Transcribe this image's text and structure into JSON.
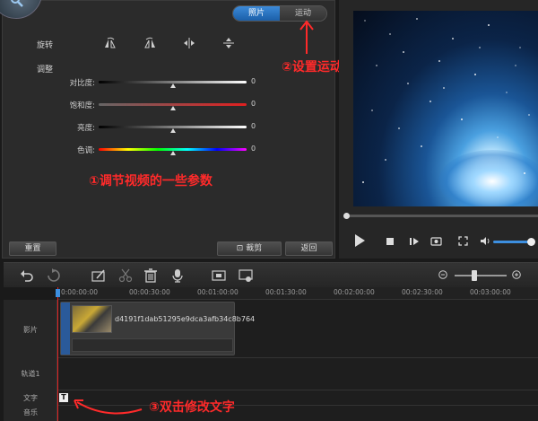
{
  "tabs": {
    "photo": "照片",
    "motion": "运动"
  },
  "edit": {
    "rotate_label": "旋转",
    "adjust_label": "调整",
    "sliders": [
      {
        "name": "对比度:",
        "value": "0",
        "level": 0.5,
        "gradient": "linear-gradient(90deg,#000,#fff)"
      },
      {
        "name": "饱和度:",
        "value": "0",
        "level": 0.5,
        "gradient": "linear-gradient(90deg,#666,#e02020)"
      },
      {
        "name": "亮度:",
        "value": "0",
        "level": 0.5,
        "gradient": "linear-gradient(90deg,#000,#fff)"
      },
      {
        "name": "色调:",
        "value": "0",
        "level": 0.5,
        "gradient": "linear-gradient(90deg,#f00,#ff0,#0f0,#0ff,#00f,#f0f)"
      }
    ],
    "reset_label": "重置",
    "crop_label": "裁剪",
    "back_label": "返回"
  },
  "annotations": {
    "a1": "①调节视频的一些参数",
    "a2": "②设置运动效果",
    "a3": "③双击修改文字"
  },
  "timeline": {
    "ticks": [
      "0:00:00:00",
      "00:00:30:00",
      "00:01:00:00",
      "00:01:30:00",
      "00:02:00:00",
      "00:02:30:00",
      "00:03:00:00"
    ],
    "tracks": {
      "video": "影片",
      "track1": "轨道1",
      "text": "文字",
      "music": "音乐"
    },
    "clip_name": "d4191f1dab51295e9dca3afb34c8b764",
    "text_badge": "T"
  },
  "colors": {
    "accent": "#3d8fe0",
    "annotation": "#ff2a2a",
    "playhead": "#e02020"
  }
}
